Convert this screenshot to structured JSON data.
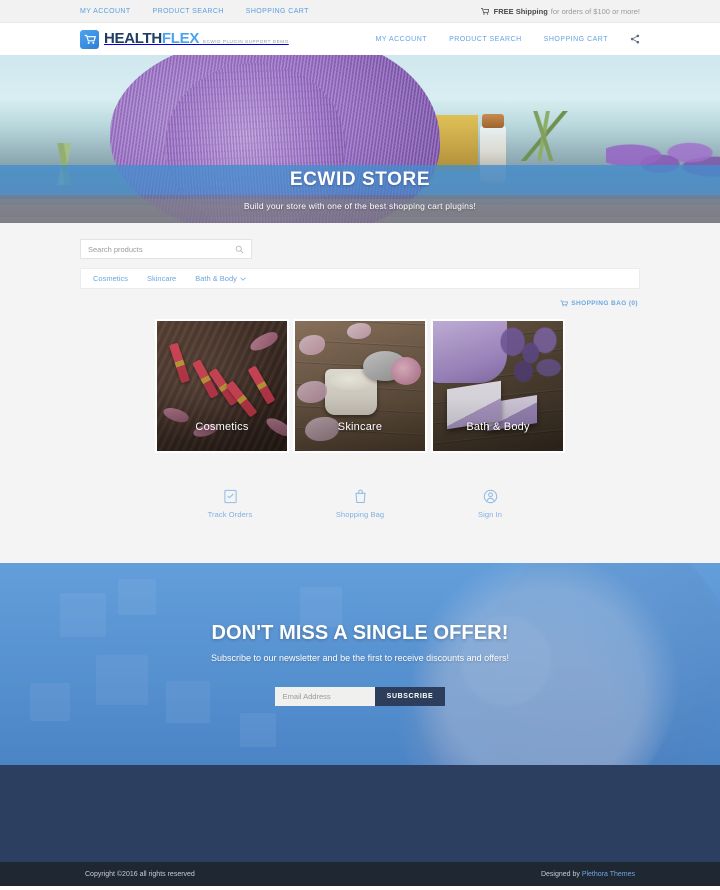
{
  "topbar": {
    "links": [
      {
        "label": "MY ACCOUNT"
      },
      {
        "label": "PRODUCT SEARCH"
      },
      {
        "label": "SHOPPING CART"
      }
    ],
    "promo_icon": "cart-icon",
    "promo_strong": "FREE Shipping",
    "promo_rest": "for orders of $100 or more!"
  },
  "header": {
    "logo_icon": "shopping-cart-logo-icon",
    "logo_part1": "HEALTH",
    "logo_part2": "FLEX",
    "logo_subtitle": "ECWID PLUGIN SUPPORT DEMO",
    "nav": [
      {
        "label": "MY ACCOUNT"
      },
      {
        "label": "PRODUCT SEARCH"
      },
      {
        "label": "SHOPPING CART"
      }
    ],
    "share_icon": "share-icon"
  },
  "hero": {
    "title": "ECWID STORE",
    "subtitle": "Build your store with one of the best shopping cart plugins!"
  },
  "store": {
    "search_placeholder": "Search products",
    "search_value": "",
    "search_icon": "search-icon",
    "categories": [
      {
        "label": "Cosmetics",
        "has_chevron": false
      },
      {
        "label": "Skincare",
        "has_chevron": false
      },
      {
        "label": "Bath & Body",
        "has_chevron": true
      }
    ],
    "bag_icon": "shopping-bag-icon",
    "bag_label": "SHOPPING BAG (0)"
  },
  "cards": [
    {
      "label": "Cosmetics",
      "art": "cosmetics"
    },
    {
      "label": "Skincare",
      "art": "skincare"
    },
    {
      "label": "Bath & Body",
      "art": "bath"
    }
  ],
  "iconlinks": [
    {
      "label": "Track Orders",
      "icon": "track-orders-icon"
    },
    {
      "label": "Shopping Bag",
      "icon": "shopping-bag-icon"
    },
    {
      "label": "Sign In",
      "icon": "sign-in-user-icon"
    }
  ],
  "newsletter": {
    "title": "DON'T MISS A SINGLE OFFER!",
    "subtitle": "Subscribe to our newsletter and be the first to receive discounts and offers!",
    "email_placeholder": "Email Address",
    "email_value": "",
    "button_label": "SUBSCRIBE"
  },
  "footer": {
    "copyright": "Copyright ©2016 all rights reserved",
    "designed_by": "Designed by",
    "designer_link": "Plethora Themes"
  },
  "colors": {
    "accent_blue": "#6ea7e0",
    "logo_navy": "#1f3c63",
    "footer_navy": "#2c3f61",
    "footer_dark": "#1f2733",
    "button_navy": "#2c3e5c"
  }
}
